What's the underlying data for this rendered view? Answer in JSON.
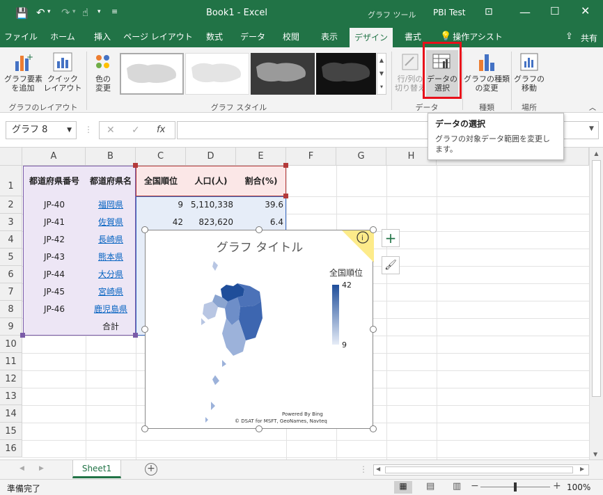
{
  "window": {
    "title": "Book1  -  Excel",
    "tool_context": "グラフ ツール",
    "account": "PBI Test"
  },
  "colors": {
    "excel_green": "#217346",
    "highlight_red": "#e8101a",
    "map_dark": "#1f4e9a"
  },
  "tabs": [
    "ファイル",
    "ホーム",
    "挿入",
    "ページ レイアウト",
    "数式",
    "データ",
    "校閲",
    "表示",
    "デザイン",
    "書式",
    "操作アシスト"
  ],
  "share": "共有",
  "ribbon": {
    "add_element": "グラフ要素\nを追加",
    "quick_layout": "クイック\nレイアウト",
    "change_color": "色の\n変更",
    "switch_rowcol": "行/列の\n切り替え",
    "select_data": "データの\n選択",
    "change_type": "グラフの種類\nの変更",
    "move_chart": "グラフの\n移動",
    "groups": {
      "layout": "グラフのレイアウト",
      "style": "グラフ スタイル",
      "data": "データ",
      "type": "種類",
      "location": "場所"
    }
  },
  "namebox": "グラフ 8",
  "fx": "fx",
  "tooltip": {
    "title": "データの選択",
    "body": "グラフの対象データ範囲を変更します。"
  },
  "columns": [
    "A",
    "B",
    "C",
    "D",
    "E",
    "F",
    "G",
    "H"
  ],
  "rows": [
    "1",
    "2",
    "3",
    "4",
    "5",
    "6",
    "7",
    "8",
    "9",
    "10",
    "11",
    "12",
    "13",
    "14",
    "15",
    "16"
  ],
  "headers": {
    "a": "都道府県番号",
    "b": "都道府県名",
    "c": "全国順位",
    "d": "人口(人)",
    "e": "割合(%)"
  },
  "data": [
    {
      "a": "JP-40",
      "b": "福岡県",
      "c": "9",
      "d": "5,110,338",
      "e": "39.6"
    },
    {
      "a": "JP-41",
      "b": "佐賀県",
      "c": "42",
      "d": "823,620",
      "e": "6.4"
    },
    {
      "a": "JP-42",
      "b": "長崎県"
    },
    {
      "a": "JP-43",
      "b": "熊本県"
    },
    {
      "a": "JP-44",
      "b": "大分県"
    },
    {
      "a": "JP-45",
      "b": "宮崎県"
    },
    {
      "a": "JP-46",
      "b": "鹿児島県"
    }
  ],
  "total_label": "合計",
  "chart": {
    "title": "グラフ タイトル",
    "legend_title": "全国順位",
    "legend_max": "42",
    "legend_min": "9",
    "credit1": "Powered By Bing",
    "credit2": "© DSAT for MSFT, GeoNames, Navteq"
  },
  "chart_data": {
    "type": "map",
    "title": "グラフ タイトル",
    "legend_title": "全国順位",
    "value_range": [
      9,
      42
    ],
    "categories": [
      "福岡県",
      "佐賀県"
    ],
    "values": [
      9,
      42
    ]
  },
  "sheet_tab": "Sheet1",
  "status": {
    "ready": "準備完了",
    "zoom": "100%"
  }
}
